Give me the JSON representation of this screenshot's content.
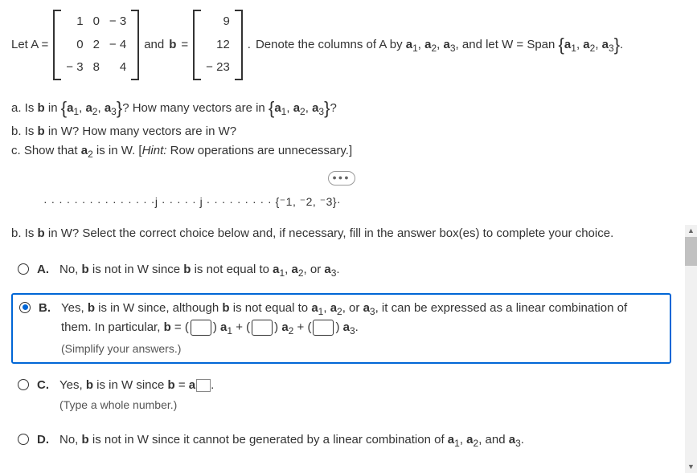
{
  "header": {
    "letA": "Let A =",
    "andB": "and",
    "bEq": "=",
    "denote": "Denote the columns of A by ",
    "letW": ", and let W = Span "
  },
  "matrixA": [
    [
      "1",
      "0",
      "− 3"
    ],
    [
      "0",
      "2",
      "− 4"
    ],
    [
      "− 3",
      "8",
      "4"
    ]
  ],
  "matrixB": [
    [
      "9"
    ],
    [
      "12"
    ],
    [
      "− 23"
    ]
  ],
  "vecList": [
    "a",
    "a",
    "a"
  ],
  "questions": {
    "a": "a. Is b in {a₁, a₂, a₃}? How many vectors are in {a₁, a₂, a₃}?",
    "b": "b. Is b in W? How many vectors are in W?",
    "c_pre": "c. Show that ",
    "c_post": " is in W. [",
    "c_hint": "Hint:",
    "c_end": " Row operations are unnecessary.]"
  },
  "partial": "· · · · · · · · · · · · · · ·j · · · · · j · · · · · · · · · {⁻1, ⁻2, ⁻3}·",
  "partB": {
    "prompt": "b. Is b in W? Select the correct choice below and, if necessary, fill in the answer box(es) to complete your choice."
  },
  "choices": {
    "A": {
      "letter": "A.",
      "text_pre": "No, ",
      "text_mid": " is not in W since ",
      "text_mid2": " is not equal to "
    },
    "B": {
      "letter": "B.",
      "line1_a": "Yes, ",
      "line1_b": " is in W since, although ",
      "line1_c": " is not equal to ",
      "line1_d": ", it can be expressed as a linear combination of",
      "line2_a": "them. In particular, ",
      "line2_b": " = ",
      "plus": " + ",
      "hint": "(Simplify your answers.)"
    },
    "C": {
      "letter": "C.",
      "text_a": "Yes, ",
      "text_b": " is in W since ",
      "text_c": " = ",
      "hint": "(Type a whole number.)"
    },
    "D": {
      "letter": "D.",
      "text_a": "No, ",
      "text_b": " is not in W since it cannot be generated by a linear combination of "
    }
  },
  "vec": {
    "a1": "a",
    "a2": "a",
    "a3": "a",
    "b": "b",
    "or": ", or ",
    "comma": ", ",
    "and": ", and ",
    "period": "."
  }
}
